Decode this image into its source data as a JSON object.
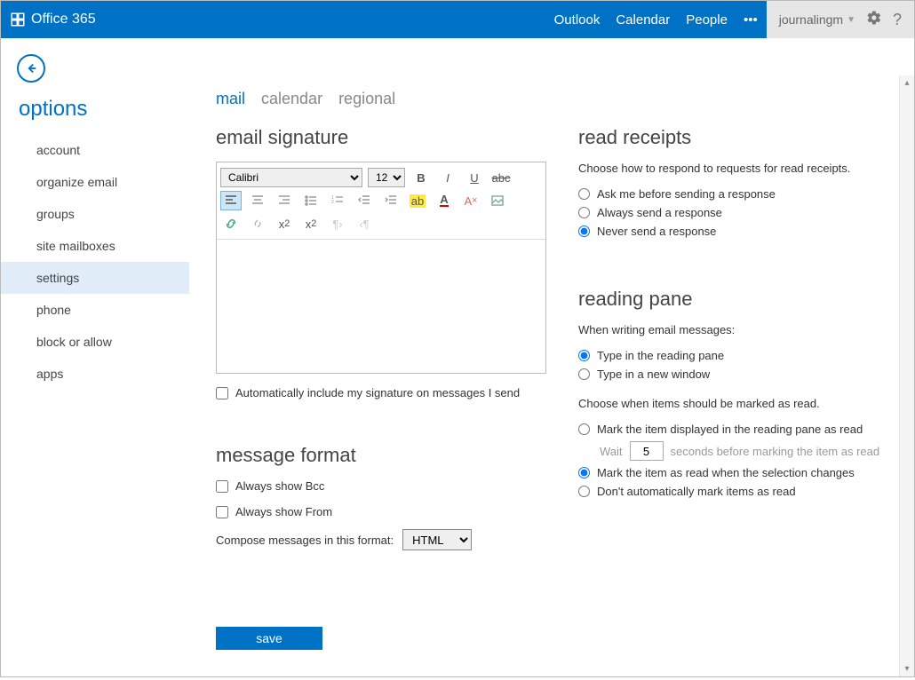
{
  "brand": "Office 365",
  "topnav": {
    "outlook": "Outlook",
    "calendar": "Calendar",
    "people": "People"
  },
  "user": "journalingm",
  "sidebar": {
    "title": "options",
    "items": [
      "account",
      "organize email",
      "groups",
      "site mailboxes",
      "settings",
      "phone",
      "block or allow",
      "apps"
    ],
    "activeIndex": 4
  },
  "tabs": {
    "mail": "mail",
    "calendar": "calendar",
    "regional": "regional",
    "active": "mail"
  },
  "signature": {
    "heading": "email signature",
    "font": "Calibri",
    "size": "12",
    "autoinclude": "Automatically include my signature on messages I send"
  },
  "messageformat": {
    "heading": "message format",
    "bcc": "Always show Bcc",
    "from": "Always show From",
    "composeLabel": "Compose messages in this format:",
    "composeValue": "HTML"
  },
  "readreceipts": {
    "heading": "read receipts",
    "desc": "Choose how to respond to requests for read receipts.",
    "opt1": "Ask me before sending a response",
    "opt2": "Always send a response",
    "opt3": "Never send a response"
  },
  "readingpane": {
    "heading": "reading pane",
    "desc1": "When writing email messages:",
    "w1": "Type in the reading pane",
    "w2": "Type in a new window",
    "desc2": "Choose when items should be marked as read.",
    "m1": "Mark the item displayed in the reading pane as read",
    "waitLabel1": "Wait",
    "waitValue": "5",
    "waitLabel2": "seconds before marking the item as read",
    "m2": "Mark the item as read when the selection changes",
    "m3": "Don't automatically mark items as read"
  },
  "save": "save"
}
